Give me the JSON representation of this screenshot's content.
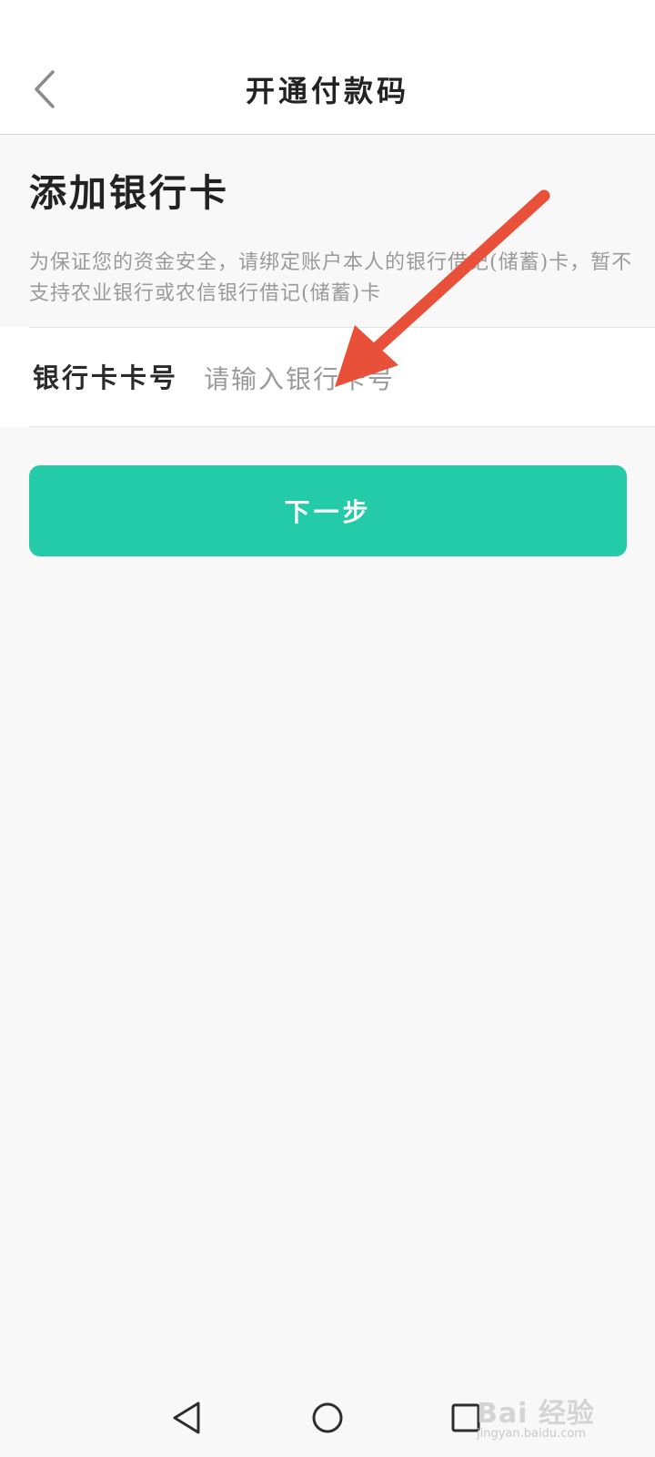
{
  "header": {
    "title": "开通付款码"
  },
  "section": {
    "title": "添加银行卡",
    "notice": "为保证您的资金安全，请绑定账户本人的银行借记(储蓄)卡，暂不支持农业银行或农信银行借记(储蓄)卡"
  },
  "card_field": {
    "label": "银行卡卡号",
    "placeholder": "请输入银行卡号",
    "value": ""
  },
  "next_button": {
    "label": "下一步"
  },
  "annotation": {
    "arrow_color": "#e8503a"
  },
  "colors": {
    "accent": "#24cba8",
    "background": "#f8f8f8"
  },
  "watermark": {
    "brand": "Bai 经验",
    "url": "jingyan.baidu.com"
  },
  "icons": {
    "back": "chevron-left-icon",
    "nav_back": "triangle-back-icon",
    "nav_home": "circle-home-icon",
    "nav_recent": "square-recent-icon"
  }
}
